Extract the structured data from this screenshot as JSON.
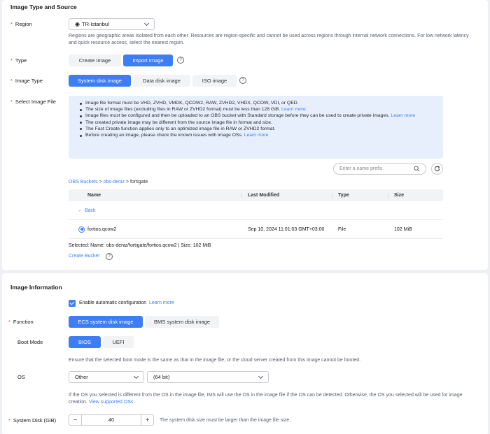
{
  "source": {
    "title": "Image Type and Source",
    "region": {
      "label": "Region",
      "value": "TR-Istanbul",
      "help": "Regions are geographic areas isolated from each other. Resources are region-specific and cannot be used across regions through internal network connections. For low network latency and quick resource access, select the nearest region."
    },
    "type": {
      "label": "Type",
      "options": [
        "Create Image",
        "Import Image"
      ],
      "selected": "Import Image"
    },
    "image_type": {
      "label": "Image Type",
      "options": [
        "System disk image",
        "Data disk image",
        "ISO image"
      ],
      "selected": "System disk image"
    },
    "select_file": {
      "label": "Select Image File",
      "info": [
        {
          "text": "Image file format must be VHD, ZVHD, VMDK, QCOW2, RAW, ZVHD2, VHDX, QCOW, VDI, or QED.",
          "link": ""
        },
        {
          "text": "The size of image files (excluding files in RAW or ZVHD2 format) must be less than 128 GiB.",
          "link": "Learn more"
        },
        {
          "text": "Image files must be configured and then be uploaded to an OBS bucket with Standard storage before they can be used to create private images.",
          "link": "Learn more"
        },
        {
          "text": "The created private image may be different from the source image file in format and size.",
          "link": ""
        },
        {
          "text": "The Fast Create function applies only to an optimized image file in RAW or ZVHD2 format.",
          "link": ""
        },
        {
          "text": "Before creating an image, please check the known issues with image OSs.",
          "link": "Learn more"
        }
      ],
      "search_placeholder": "Enter a name prefix.",
      "breadcrumb": {
        "root": "OBS Buckets",
        "bucket": "obs-deniz",
        "folder": "fortigate"
      },
      "columns": [
        "Name",
        "Last Modified",
        "Type",
        "Size"
      ],
      "back_label": "Back",
      "rows": [
        {
          "name": "fortios.qcow2",
          "modified": "Sep 10, 2024 11:01:03 GMT+03:00",
          "type": "File",
          "size": "102 MiB"
        }
      ],
      "selected_label": "Selected: Name:",
      "selected_path": "obs-deniz/fortigate/fortios.qcow2",
      "selected_size": "| Size: 102 MiB",
      "create_bucket": "Create Bucket"
    }
  },
  "info": {
    "title": "Image Information",
    "auto_config": {
      "label": "Enable automatic configuration",
      "link": "Learn more",
      "checked": true
    },
    "function": {
      "label": "Function",
      "options": [
        "ECS system disk image",
        "BMS system disk image"
      ],
      "selected": "ECS system disk image"
    },
    "boot_mode": {
      "label": "Boot Mode",
      "options": [
        "BIOS",
        "UEFI"
      ],
      "selected": "BIOS",
      "help": "Ensure that the selected boot mode is the same as that in the image file, or the cloud server created from this image cannot be booted."
    },
    "os": {
      "label": "OS",
      "value": "Other",
      "bits": "(64 bit)",
      "help": "If the OS you selected is different from the OS in the image file, IMS will use the OS in the image file if the OS can be detected. Otherwise, the OS you selected will be used for image creation.",
      "help_link": "View supported OSs"
    },
    "system_disk": {
      "label": "System Disk (GiB)",
      "minus": "−",
      "value": "40",
      "plus": "+",
      "help": "The system disk size must be larger than the image file size."
    }
  },
  "colors": {
    "accent": "#3d7ef5",
    "required": "#e63b3b",
    "info_bg": "#e7effc"
  }
}
